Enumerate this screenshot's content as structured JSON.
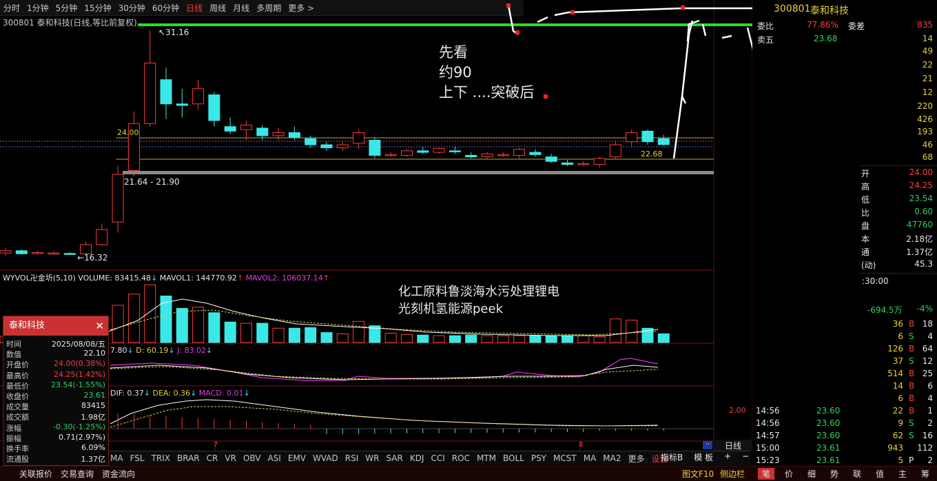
{
  "periods": [
    {
      "label": "分时",
      "active": false
    },
    {
      "label": "1分钟",
      "active": false
    },
    {
      "label": "5分钟",
      "active": false
    },
    {
      "label": "15分钟",
      "active": false
    },
    {
      "label": "30分钟",
      "active": false
    },
    {
      "label": "60分钟",
      "active": false
    },
    {
      "label": "日线",
      "active": true
    },
    {
      "label": "周线",
      "active": false
    },
    {
      "label": "月线",
      "active": false
    },
    {
      "label": "多周期",
      "active": false
    },
    {
      "label": "更多 >",
      "active": false
    }
  ],
  "chart_title": "300801 泰和科技(日线,等比前复权)",
  "price_labels": {
    "high": "31.16",
    "low": "16.32",
    "line_24": "24.00",
    "range": "21.64 - 21.90",
    "line_2268": "22.68"
  },
  "annotations": {
    "note1": [
      "先看",
      "约90",
      "上下 ....突破后"
    ],
    "note2": [
      "化工原料鲁淡海水污处理锂电",
      "光刻机氢能源peek"
    ]
  },
  "volume_header": {
    "name": "WYVOL卍金圻(5,10)",
    "volume": "VOLUME: 83415.48",
    "mavol1": "MAVOL1: 144770.92",
    "mavol2": "MAVOL2: 106037.14"
  },
  "kdj_header": {
    "k": "7.80",
    "d": "D: 60.19",
    "j": "J: 83.02"
  },
  "macd_header": {
    "dif": "DIF: 0.37",
    "dea": "DEA: 0.36",
    "macd": "MACD: 0.01"
  },
  "macd_axis": "2.00",
  "month_marks": [
    "7",
    "8"
  ],
  "popup": {
    "title": "泰和科技",
    "rows": [
      {
        "k": "时间",
        "v": "2025/08/08/五",
        "c": "white"
      },
      {
        "k": "数值",
        "v": "22.10",
        "c": "white"
      },
      {
        "k": "开盘价",
        "v": "24.00(0.38%)",
        "c": "red"
      },
      {
        "k": "最高价",
        "v": "24.25(1.42%)",
        "c": "red"
      },
      {
        "k": "最低价",
        "v": "23.54(-1.55%)",
        "c": "green"
      },
      {
        "k": "收盘价",
        "v": "23.61",
        "c": "green"
      },
      {
        "k": "成交量",
        "v": "83415",
        "c": "white"
      },
      {
        "k": "成交额",
        "v": "1.98亿",
        "c": "white"
      },
      {
        "k": "涨幅",
        "v": "-0.30(-1.25%)",
        "c": "green"
      },
      {
        "k": "振幅",
        "v": "0.71(2.97%)",
        "c": "white"
      },
      {
        "k": "换手率",
        "v": "6.09%",
        "c": "white"
      },
      {
        "k": "流通股",
        "v": "1.37亿",
        "c": "white"
      }
    ]
  },
  "indicators": [
    "MA",
    "FSL",
    "TRIX",
    "BRAR",
    "CR",
    "VR",
    "OBV",
    "ASI",
    "EMV",
    "WVAD",
    "RSI",
    "WR",
    "SAR",
    "KDJ",
    "CCI",
    "ROC",
    "MTM",
    "BOLL",
    "PSY",
    "MCST",
    "MA",
    "MA2",
    "更多",
    "设置"
  ],
  "indicator_right": [
    "指标B",
    "模 板",
    "+",
    "−"
  ],
  "status": {
    "left": [
      "关联报价",
      "交易查询",
      "资金流向"
    ],
    "right": [
      "图文F10",
      "侧边栏"
    ],
    "tabs": [
      "笔",
      "价",
      "细",
      "势",
      "联",
      "值",
      "主",
      "筹"
    ]
  },
  "right_panel": {
    "code": "300801",
    "name": "泰和科技",
    "weibi": {
      "label": "委比",
      "value": "77.86%",
      "diff_label": "委差",
      "diff": "835"
    },
    "sell5": {
      "label": "卖五",
      "price": "23.68",
      "vol": "14"
    },
    "asks": [
      "49",
      "22",
      "21",
      "12"
    ],
    "bids": [
      "220",
      "426",
      "193",
      "46",
      "68"
    ],
    "stats": [
      {
        "k": "开",
        "v": "24.00",
        "c": "red"
      },
      {
        "k": "高",
        "v": "24.25",
        "c": "red"
      },
      {
        "k": "低",
        "v": "23.54",
        "c": "green"
      },
      {
        "k": "比",
        "v": "0.60",
        "c": "green"
      },
      {
        "k": "盘",
        "v": "47760",
        "c": "green"
      },
      {
        "k": "本",
        "v": "2.18亿",
        "c": "white"
      },
      {
        "k": "通",
        "v": "1.37亿",
        "c": "white"
      },
      {
        "k": "(动)",
        "v": "45.3",
        "c": "white"
      }
    ],
    "time_hdr": ":30:00",
    "flow": {
      "amount": "-694.5万",
      "pct": "-4%"
    },
    "ticks_a": [
      {
        "v": "36",
        "bs": "B",
        "n": "18"
      },
      {
        "v": "6",
        "bs": "S",
        "n": "4"
      },
      {
        "v": "126",
        "bs": "B",
        "n": "64"
      },
      {
        "v": "37",
        "bs": "S",
        "n": "12"
      },
      {
        "v": "514",
        "bs": "B",
        "n": "25"
      },
      {
        "v": "14",
        "bs": "B",
        "n": "6"
      },
      {
        "v": "6",
        "bs": "B",
        "n": "4"
      },
      {
        "v": "22",
        "bs": "B",
        "n": "1"
      },
      {
        "v": "9",
        "bs": "S",
        "n": "2"
      },
      {
        "v": "62",
        "bs": "S",
        "n": "16"
      },
      {
        "v": "943",
        "bs": "",
        "n": "112"
      },
      {
        "v": "5",
        "bs": "P",
        "n": "2"
      }
    ],
    "ticks_b": [
      {
        "t": "14:56",
        "p": "23.60"
      },
      {
        "t": "14:56",
        "p": "23.60"
      },
      {
        "t": "14:57",
        "p": "23.60"
      },
      {
        "t": "15:00",
        "p": "23.61"
      },
      {
        "t": "15:23",
        "p": "23.61"
      }
    ]
  },
  "day_tab": "日线",
  "candles": [
    {
      "o": 16.45,
      "h": 16.8,
      "l": 16.3,
      "c": 16.6
    },
    {
      "o": 16.6,
      "h": 16.7,
      "l": 16.35,
      "c": 16.4
    },
    {
      "o": 16.45,
      "h": 16.6,
      "l": 16.35,
      "c": 16.48
    },
    {
      "o": 16.42,
      "h": 16.55,
      "l": 16.32,
      "c": 16.45
    },
    {
      "o": 16.42,
      "h": 16.5,
      "l": 16.32,
      "c": 16.38
    },
    {
      "o": 16.4,
      "h": 17.2,
      "l": 16.32,
      "c": 17.0
    },
    {
      "o": 17.0,
      "h": 18.4,
      "l": 16.9,
      "c": 18.0
    },
    {
      "o": 18.5,
      "h": 22.2,
      "l": 17.8,
      "c": 21.64
    },
    {
      "o": 21.9,
      "h": 25.8,
      "l": 21.5,
      "c": 25.0
    },
    {
      "o": 25.0,
      "h": 31.16,
      "l": 24.8,
      "c": 29.0
    },
    {
      "o": 27.9,
      "h": 28.7,
      "l": 25.3,
      "c": 26.3
    },
    {
      "o": 26.3,
      "h": 27.3,
      "l": 25.4,
      "c": 26.2
    },
    {
      "o": 26.3,
      "h": 27.9,
      "l": 25.9,
      "c": 27.3
    },
    {
      "o": 26.9,
      "h": 27.1,
      "l": 24.8,
      "c": 25.2
    },
    {
      "o": 24.8,
      "h": 25.4,
      "l": 24.3,
      "c": 24.5
    },
    {
      "o": 24.6,
      "h": 25.2,
      "l": 23.9,
      "c": 24.9
    },
    {
      "o": 24.7,
      "h": 24.9,
      "l": 23.9,
      "c": 24.2
    },
    {
      "o": 24.2,
      "h": 24.7,
      "l": 23.9,
      "c": 24.4
    },
    {
      "o": 24.4,
      "h": 24.8,
      "l": 23.9,
      "c": 24.1
    },
    {
      "o": 24.0,
      "h": 24.2,
      "l": 23.4,
      "c": 23.6
    },
    {
      "o": 23.6,
      "h": 23.8,
      "l": 23.2,
      "c": 23.4
    },
    {
      "o": 23.4,
      "h": 23.8,
      "l": 23.2,
      "c": 23.6
    },
    {
      "o": 23.7,
      "h": 24.6,
      "l": 23.3,
      "c": 24.4
    },
    {
      "o": 23.9,
      "h": 24.1,
      "l": 22.7,
      "c": 22.9
    },
    {
      "o": 22.9,
      "h": 23.1,
      "l": 22.8,
      "c": 22.95
    },
    {
      "o": 22.9,
      "h": 23.3,
      "l": 22.8,
      "c": 23.2
    },
    {
      "o": 23.2,
      "h": 23.5,
      "l": 23.0,
      "c": 23.1
    },
    {
      "o": 23.1,
      "h": 23.4,
      "l": 23.0,
      "c": 23.35
    },
    {
      "o": 23.2,
      "h": 23.5,
      "l": 23.0,
      "c": 23.15
    },
    {
      "o": 22.9,
      "h": 23.1,
      "l": 22.7,
      "c": 22.8
    },
    {
      "o": 22.8,
      "h": 23.1,
      "l": 22.7,
      "c": 23.0
    },
    {
      "o": 22.9,
      "h": 23.1,
      "l": 22.8,
      "c": 22.95
    },
    {
      "o": 22.9,
      "h": 23.4,
      "l": 22.7,
      "c": 23.3
    },
    {
      "o": 23.1,
      "h": 23.3,
      "l": 22.8,
      "c": 22.95
    },
    {
      "o": 22.8,
      "h": 23.0,
      "l": 22.4,
      "c": 22.5
    },
    {
      "o": 22.4,
      "h": 22.6,
      "l": 22.2,
      "c": 22.3
    },
    {
      "o": 22.3,
      "h": 22.5,
      "l": 22.2,
      "c": 22.35
    },
    {
      "o": 22.3,
      "h": 22.8,
      "l": 22.1,
      "c": 22.7
    },
    {
      "o": 22.8,
      "h": 23.8,
      "l": 22.7,
      "c": 23.6
    },
    {
      "o": 23.8,
      "h": 24.6,
      "l": 23.5,
      "c": 24.4
    },
    {
      "o": 24.5,
      "h": 24.6,
      "l": 23.6,
      "c": 23.8
    },
    {
      "o": 24.0,
      "h": 24.25,
      "l": 23.54,
      "c": 23.61
    }
  ],
  "volumes": [
    0.1,
    0.1,
    0.1,
    0.1,
    0.1,
    0.15,
    0.25,
    0.6,
    0.78,
    0.93,
    0.75,
    0.55,
    0.57,
    0.48,
    0.33,
    0.31,
    0.31,
    0.23,
    0.23,
    0.24,
    0.16,
    0.14,
    0.34,
    0.27,
    0.15,
    0.13,
    0.12,
    0.11,
    0.11,
    0.12,
    0.11,
    0.11,
    0.11,
    0.11,
    0.11,
    0.11,
    0.11,
    0.09,
    0.38,
    0.36,
    0.23,
    0.14
  ]
}
